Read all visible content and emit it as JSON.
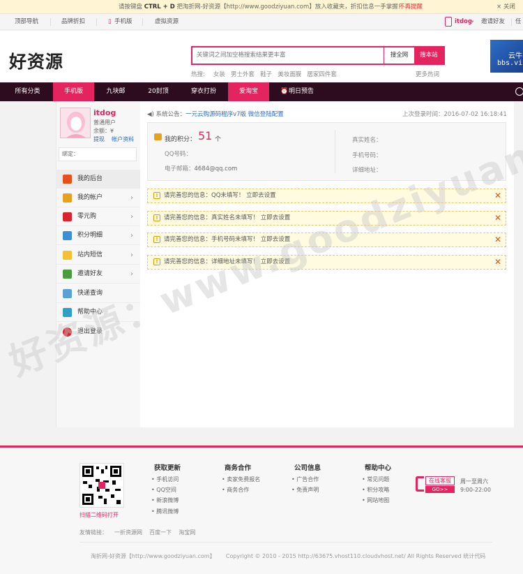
{
  "tipbar": {
    "message_pre": "请按键盘 ",
    "keys": "CTRL + D",
    "message_post": " 把淘折网-好资源【http://www.goodziyuan.com】放入收藏夹，折扣信息一手掌握！",
    "no_more": "不再提醒",
    "close": "× 关闭"
  },
  "topnav": {
    "items": [
      "顶部导航",
      "品牌折扣",
      "手机版",
      "虚拟资源"
    ],
    "user": "itdog",
    "invite": "邀请好友",
    "right_cut": "任"
  },
  "header": {
    "logo": "好资源",
    "search_placeholder": "关键词之间加空格搜索结果更丰富",
    "btn_all": "搜全网",
    "btn_site": "搜本站",
    "hot_label": "热搜:",
    "hot_words": [
      "女装",
      "男士外套",
      "鞋子",
      "美妆面膜",
      "居家四件套"
    ],
    "more_hot": "更多热词",
    "ad_line1": "云牛",
    "ad_line2": "bbs.vi"
  },
  "catnav": {
    "items": [
      "所有分类",
      "手机版",
      "九块邮",
      "20封顶",
      "穿衣打扮",
      "爱淘宝",
      "明日预告"
    ]
  },
  "user": {
    "name": "itdog",
    "role": "普通用户",
    "balance": "余额：¥",
    "link_withdraw": "提现",
    "link_profile": "帐户资料",
    "bind_label": "绑定："
  },
  "menu": [
    {
      "label": "我的后台",
      "color": "#e8501b",
      "arrow": ""
    },
    {
      "label": "我的帐户",
      "color": "#e6a11f",
      "arrow": "›"
    },
    {
      "label": "零元购",
      "color": "#d9232f",
      "arrow": "›"
    },
    {
      "label": "积分明细",
      "color": "#3a8fd6",
      "arrow": "›"
    },
    {
      "label": "站内短信",
      "color": "#f2c232",
      "arrow": "›"
    },
    {
      "label": "邀请好友",
      "color": "#4a9d3c",
      "arrow": "›"
    },
    {
      "label": "快递查询",
      "color": "#5aa0d8",
      "arrow": ""
    },
    {
      "label": "帮助中心",
      "color": "#2f9fc7",
      "arrow": ""
    },
    {
      "label": "退出登录",
      "color": "#d9232f",
      "arrow": ""
    }
  ],
  "notice": {
    "label": "系统公告：",
    "link": "一元云购源码程序v7版 微信登陆配置",
    "last_login": "上次登录时间：2016-07-02 16:18:41"
  },
  "info": {
    "points_label": "我的积分：",
    "points_value": "51",
    "points_unit": "个",
    "qq_label": "QQ号码：",
    "email_label": "电子邮箱：",
    "email_value": "4684@qq.com",
    "real_name_label": "真实姓名：",
    "phone_label": "手机号码：",
    "address_label": "详细地址："
  },
  "alerts": [
    {
      "text": "请完善您的信息：QQ未填写！",
      "action": "立即去设置"
    },
    {
      "text": "请完善您的信息：真实姓名未填写！",
      "action": "立即去设置"
    },
    {
      "text": "请完善您的信息：手机号码未填写！",
      "action": "立即去设置"
    },
    {
      "text": "请完善您的信息：详细地址未填写！",
      "action": "立即去设置"
    }
  ],
  "watermark": "好资源：www.goodziyuan.com",
  "footer": {
    "qr_label": "扫描二维码打开",
    "columns": [
      {
        "title": "获取更新",
        "items": [
          "手机访问",
          "QQ空间",
          "新浪微博",
          "腾讯微博"
        ]
      },
      {
        "title": "商务合作",
        "items": [
          "卖家免费报名",
          "商务合作"
        ]
      },
      {
        "title": "公司信息",
        "items": [
          "广告合作",
          "免责声明"
        ]
      },
      {
        "title": "帮助中心",
        "items": [
          "常见问题",
          "积分攻略",
          "网站地图"
        ]
      }
    ],
    "service_label": "在线客服",
    "service_go": "GO>>",
    "hours_line1": "周一至周六",
    "hours_line2": "9:00-22:00",
    "friend_label": "友情链接：",
    "friend_links": [
      "一折资源网",
      "百度一下",
      "淘宝网"
    ],
    "copyright_left": "淘折网-好资源【http://www.goodziyuan.com】",
    "copyright_right": "Copyright © 2010 - 2015 http://63675.vhost110.cloudvhost.net/ All Rights Reserved 统计代码"
  }
}
